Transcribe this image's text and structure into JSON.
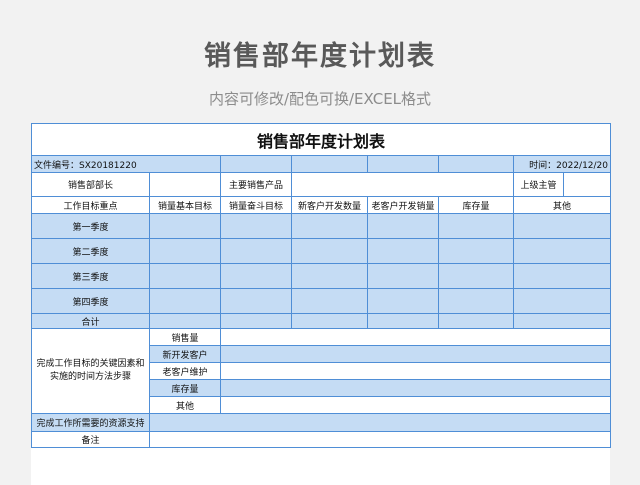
{
  "header": {
    "title": "销售部年度计划表",
    "subtitle": "内容可修改/配色可换/EXCEL格式"
  },
  "sheet": {
    "title": "销售部年度计划表",
    "file_no": "文件编号：SX20181220",
    "time": "时间：2022/12/20",
    "sales_manager_label": "销售部部长",
    "main_products_label": "主要销售产品",
    "supervisor_label": "上级主管",
    "columns": [
      "工作目标重点",
      "销量基本目标",
      "销量奋斗目标",
      "新客户开发数量",
      "老客户开发销量",
      "库存量",
      "其他"
    ],
    "quarters": [
      "第一季度",
      "第二季度",
      "第三季度",
      "第四季度"
    ],
    "total_label": "合计",
    "key_factors_label": "完成工作目标的关键因素和实施的时间方法步骤",
    "factors": [
      "销售量",
      "新开发客户",
      "老客户维护",
      "库存量",
      "其他"
    ],
    "resources_label": "完成工作所需要的资源支持",
    "remarks_label": "备注"
  },
  "colors": {
    "border": "#4f8ed6",
    "fill": "#c5dcf4",
    "title_text": "#595959",
    "subtitle_text": "#8c8c8c"
  }
}
